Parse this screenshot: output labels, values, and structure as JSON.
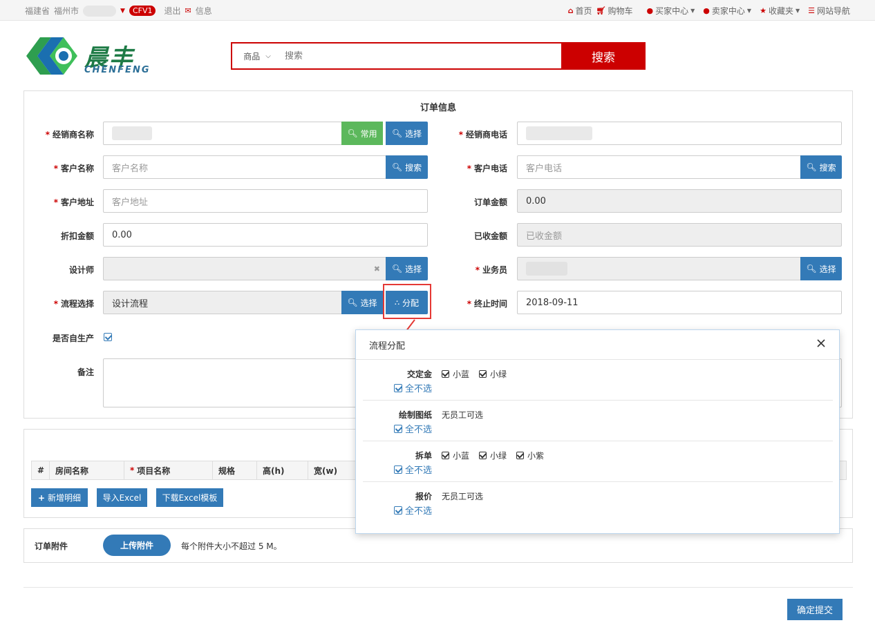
{
  "topbar": {
    "province": "福建省",
    "city": "福州市",
    "badge": "CFV1",
    "logout": "退出",
    "messages": "信息",
    "nav": {
      "home": "首页",
      "cart": "购物车",
      "buyer": "买家中心",
      "seller": "卖家中心",
      "favorites": "收藏夹",
      "sitemap": "网站导航"
    }
  },
  "logo": {
    "cn": "晨丰",
    "en": "CHENFENG"
  },
  "search": {
    "category": "商品",
    "placeholder": "搜索",
    "button": "搜索"
  },
  "form": {
    "title": "订单信息",
    "dealer_name": "经销商名称",
    "common_btn": "常用",
    "select_btn": "选择",
    "search_btn": "搜索",
    "assign_btn": "分配",
    "dealer_phone": "经销商电话",
    "customer_name": "客户名称",
    "customer_name_ph": "客户名称",
    "customer_phone": "客户电话",
    "customer_phone_ph": "客户电话",
    "customer_address": "客户地址",
    "customer_address_ph": "客户地址",
    "order_amount": "订单金额",
    "order_amount_val": "0.00",
    "discount": "折扣金额",
    "discount_val": "0.00",
    "received": "已收金额",
    "received_ph": "已收金额",
    "designer": "设计师",
    "clear_x": "✖",
    "salesman": "业务员",
    "flow": "流程选择",
    "flow_val": "设计流程",
    "end_time": "终止时间",
    "end_time_val": "2018-09-11",
    "self_produce": "是否自生产",
    "remark": "备注"
  },
  "details": {
    "columns": [
      "#",
      "房间名称",
      "项目名称",
      "规格",
      "高(h)",
      "宽(w)"
    ],
    "add_btn": "新增明细",
    "import_btn": "导入Excel",
    "download_btn": "下载Excel模板"
  },
  "attachments": {
    "label": "订单附件",
    "upload_btn": "上传附件",
    "hint": "每个附件大小不超过 5 M。"
  },
  "submit_btn": "确定提交",
  "modal": {
    "title": "流程分配",
    "deselect_all": "全不选",
    "no_staff": "无员工可选",
    "rows": [
      {
        "label": "交定金",
        "options": [
          "小蓝",
          "小绿"
        ]
      },
      {
        "label": "绘制图纸",
        "options": []
      },
      {
        "label": "拆单",
        "options": [
          "小蓝",
          "小绿",
          "小紫"
        ]
      },
      {
        "label": "报价",
        "options": []
      }
    ]
  }
}
